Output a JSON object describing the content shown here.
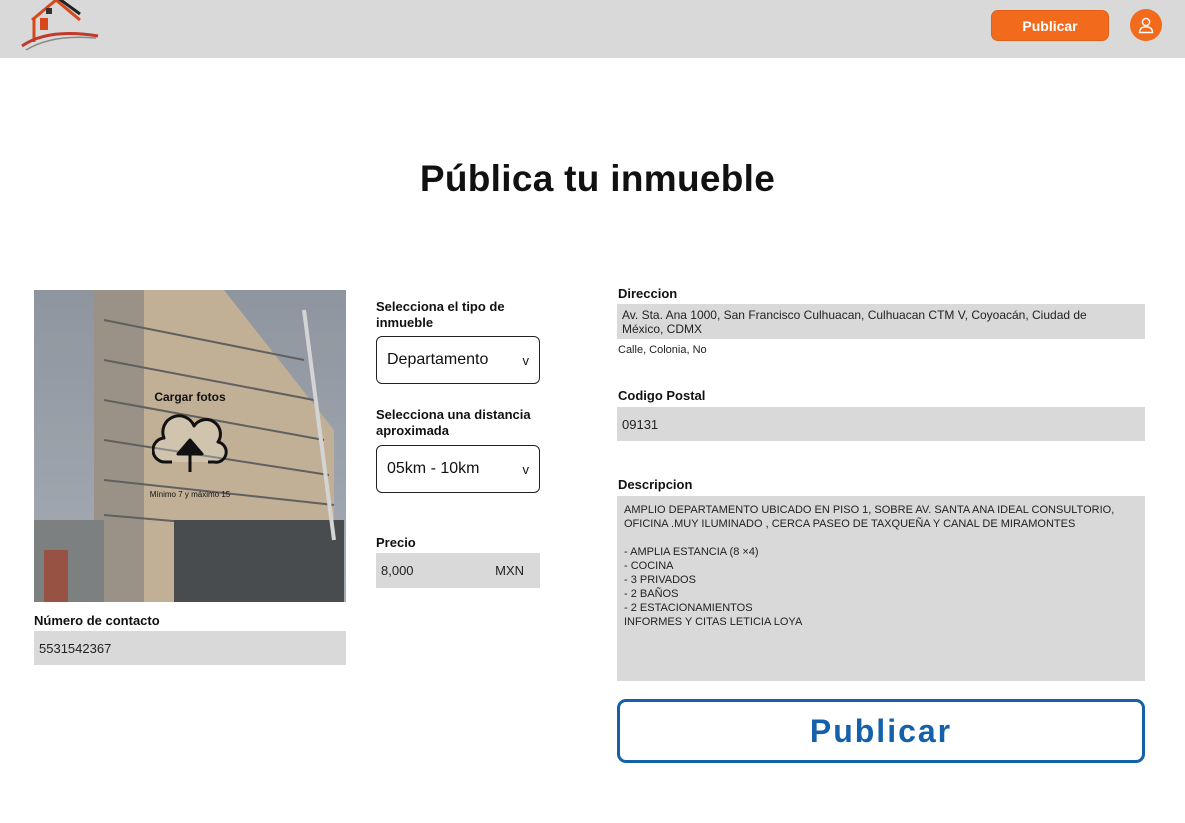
{
  "header": {
    "publish_button": "Publicar",
    "colors": {
      "bar": "#d9d9d9",
      "accent": "#f26b1d"
    },
    "icons": {
      "logo": "house-logo",
      "profile": "user-icon"
    }
  },
  "page": {
    "title": "Pública tu inmueble"
  },
  "photo_upload": {
    "label": "Cargar fotos",
    "hint": "Mínimo 7 y máximo 15",
    "icon": "cloud-upload-icon"
  },
  "contact": {
    "label": "Número de contacto",
    "value": "5531542367"
  },
  "property_type": {
    "label": "Selecciona el tipo de inmueble",
    "value": "Departamento",
    "chevron": "v"
  },
  "distance": {
    "label": "Selecciona una distancia aproximada",
    "value": "05km - 10km",
    "chevron": "v"
  },
  "price": {
    "label": "Precio",
    "value": "8,000",
    "currency": "MXN"
  },
  "address": {
    "label": "Direccion",
    "value": " Av. Sta. Ana 1000, San Francisco Culhuacan, Culhuacan CTM V, Coyoacán, Ciudad de México, CDMX",
    "hint": "Calle, Colonia, No"
  },
  "postal_code": {
    "label": "Codigo Postal",
    "value": "09131"
  },
  "description": {
    "label": "Descripcion",
    "value": "AMPLIO DEPARTAMENTO UBICADO EN PISO 1, SOBRE AV. SANTA ANA IDEAL CONSULTORIO, OFICINA .MUY ILUMINADO , CERCA PASEO DE TAXQUEÑA Y CANAL DE MIRAMONTES\n\n- AMPLIA ESTANCIA (8 ×4)\n- COCINA\n- 3 PRIVADOS\n- 2 BAÑOS\n- 2 ESTACIONAMIENTOS\nINFORMES Y CITAS LETICIA LOYA"
  },
  "submit": {
    "label": "Publicar",
    "color": "#1460aa"
  }
}
